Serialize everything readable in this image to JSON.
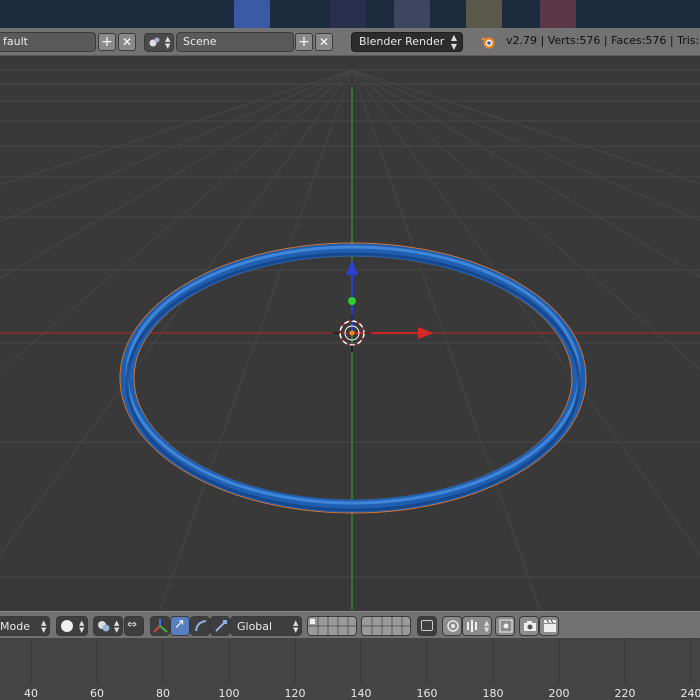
{
  "header": {
    "layout_field": "fault",
    "scene_field": "Scene",
    "renderer": "Blender Render",
    "stats": "v2.79 | Verts:576 | Faces:576 | Tris:1,1"
  },
  "view_header": {
    "mode": "Mode",
    "orientation": "Global"
  },
  "timeline": {
    "ticks": [
      "40",
      "60",
      "80",
      "100",
      "120",
      "140",
      "160",
      "180",
      "200",
      "220",
      "240"
    ]
  },
  "colors": {
    "torus": "#1f63b8",
    "selection_outline": "#e0782c",
    "axis_x": "#b32525",
    "axis_y": "#3aa33a",
    "grid": "#474747"
  }
}
